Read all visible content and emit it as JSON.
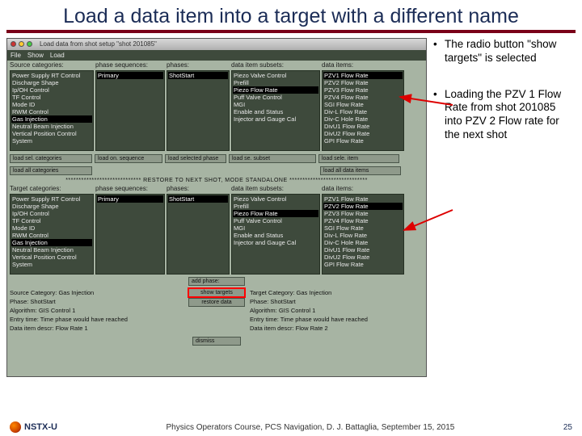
{
  "title": "Load a data item into a target with a different name",
  "bullets": [
    "The radio button \"show targets\" is selected",
    "Loading the PZV 1 Flow Rate from shot 201085 into PZV 2 Flow rate for the next shot"
  ],
  "window_title": "Load data from shot setup \"shot 201085\"",
  "menu": {
    "file": "File",
    "show": "Show",
    "load": "Load"
  },
  "headers": {
    "src_cat": "Source categories:",
    "ph_seq": "phase sequences:",
    "phases": "phases:",
    "subsets": "data item subsets:",
    "items": "data items:",
    "tgt_cat": "Target categories:"
  },
  "src": {
    "cat": [
      "Power Supply RT Control",
      "Discharge Shape",
      "Ip/OH Control",
      "TF Control",
      "Mode ID",
      "RWM Control",
      "Gas Injection",
      "Neutral Beam Injection",
      "Vertical Position Control",
      "System"
    ],
    "seq": [
      "Primary"
    ],
    "phase": [
      "ShotStart"
    ],
    "subset": [
      "Piezo Valve Control",
      "Prefill",
      "Piezo Flow Rate",
      "Puff Valve Control",
      "MGI",
      "Enable and Status",
      "Injector and Gauge Cal"
    ],
    "items": [
      "PZV1 Flow Rate",
      "PZV2 Flow Rate",
      "PZV3 Flow Rate",
      "PZV4 Flow Rate",
      "SGI Flow Rate",
      "Div-L Flow Rate",
      "Div-C Hole Rate",
      "DivU1 Flow Rate",
      "DivU2 Flow Rate",
      "GPI Flow Rate"
    ]
  },
  "tgt": {
    "cat": [
      "Power Supply RT Control",
      "Discharge Shape",
      "Ip/OH Control",
      "TF Control",
      "Mode ID",
      "RWM Control",
      "Gas Injection",
      "Neutral Beam Injection",
      "Vertical Position Control",
      "System"
    ],
    "seq": [
      "Primary"
    ],
    "phase": [
      "ShotStart"
    ],
    "subset": [
      "Piezo Valve Control",
      "Prefill",
      "Piezo Flow Rate",
      "Puff Valve Control",
      "MGI",
      "Enable and Status",
      "Injector and Gauge Cal"
    ],
    "items": [
      "PZV1 Flow Rate",
      "PZV2 Flow Rate",
      "PZV3 Flow Rate",
      "PZV4 Flow Rate",
      "SGI Flow Rate",
      "Div-L Flow Rate",
      "Div-C Hole Rate",
      "DivU1 Flow Rate",
      "DivU2 Flow Rate",
      "GPI Flow Rate"
    ]
  },
  "buttons": {
    "load_sel_cat": "load sel. categories",
    "load_on_seq": "load on. sequence",
    "load_selected_phase": "load selected phase",
    "load_se_subset": "load se. subset",
    "load_sele_item": "load sele. item",
    "load_all_categories": "load all categories",
    "load_all_data_items": "load all data items",
    "add_phase": "add phase:",
    "show_targets": "show targets",
    "restore_data": "restore data",
    "dismiss": "dismiss"
  },
  "restore_banner": "*****************************  RESTORE TO NEXT SHOT, MODE STANDALONE  ******************************",
  "info": {
    "left": {
      "l1": "Source Category: Gas Injection",
      "l2": "Phase: ShotStart",
      "l3": "Algorithm: GIS Control 1",
      "l4": "Entry time: Time phase would have reached",
      "l5": "Data item descr: Flow Rate 1"
    },
    "right": {
      "l1": "Target Category: Gas Injection",
      "l2": "Phase: ShotStart",
      "l3": "Algorithm: GIS Control 1",
      "l4": "Entry time: Time phase would have reached",
      "l5": "Data item descr: Flow Rate 2"
    }
  },
  "footer": {
    "logo": "NSTX-U",
    "center": "Physics Operators Course, PCS Navigation, D. J. Battaglia, September 15, 2015",
    "page": "25"
  }
}
